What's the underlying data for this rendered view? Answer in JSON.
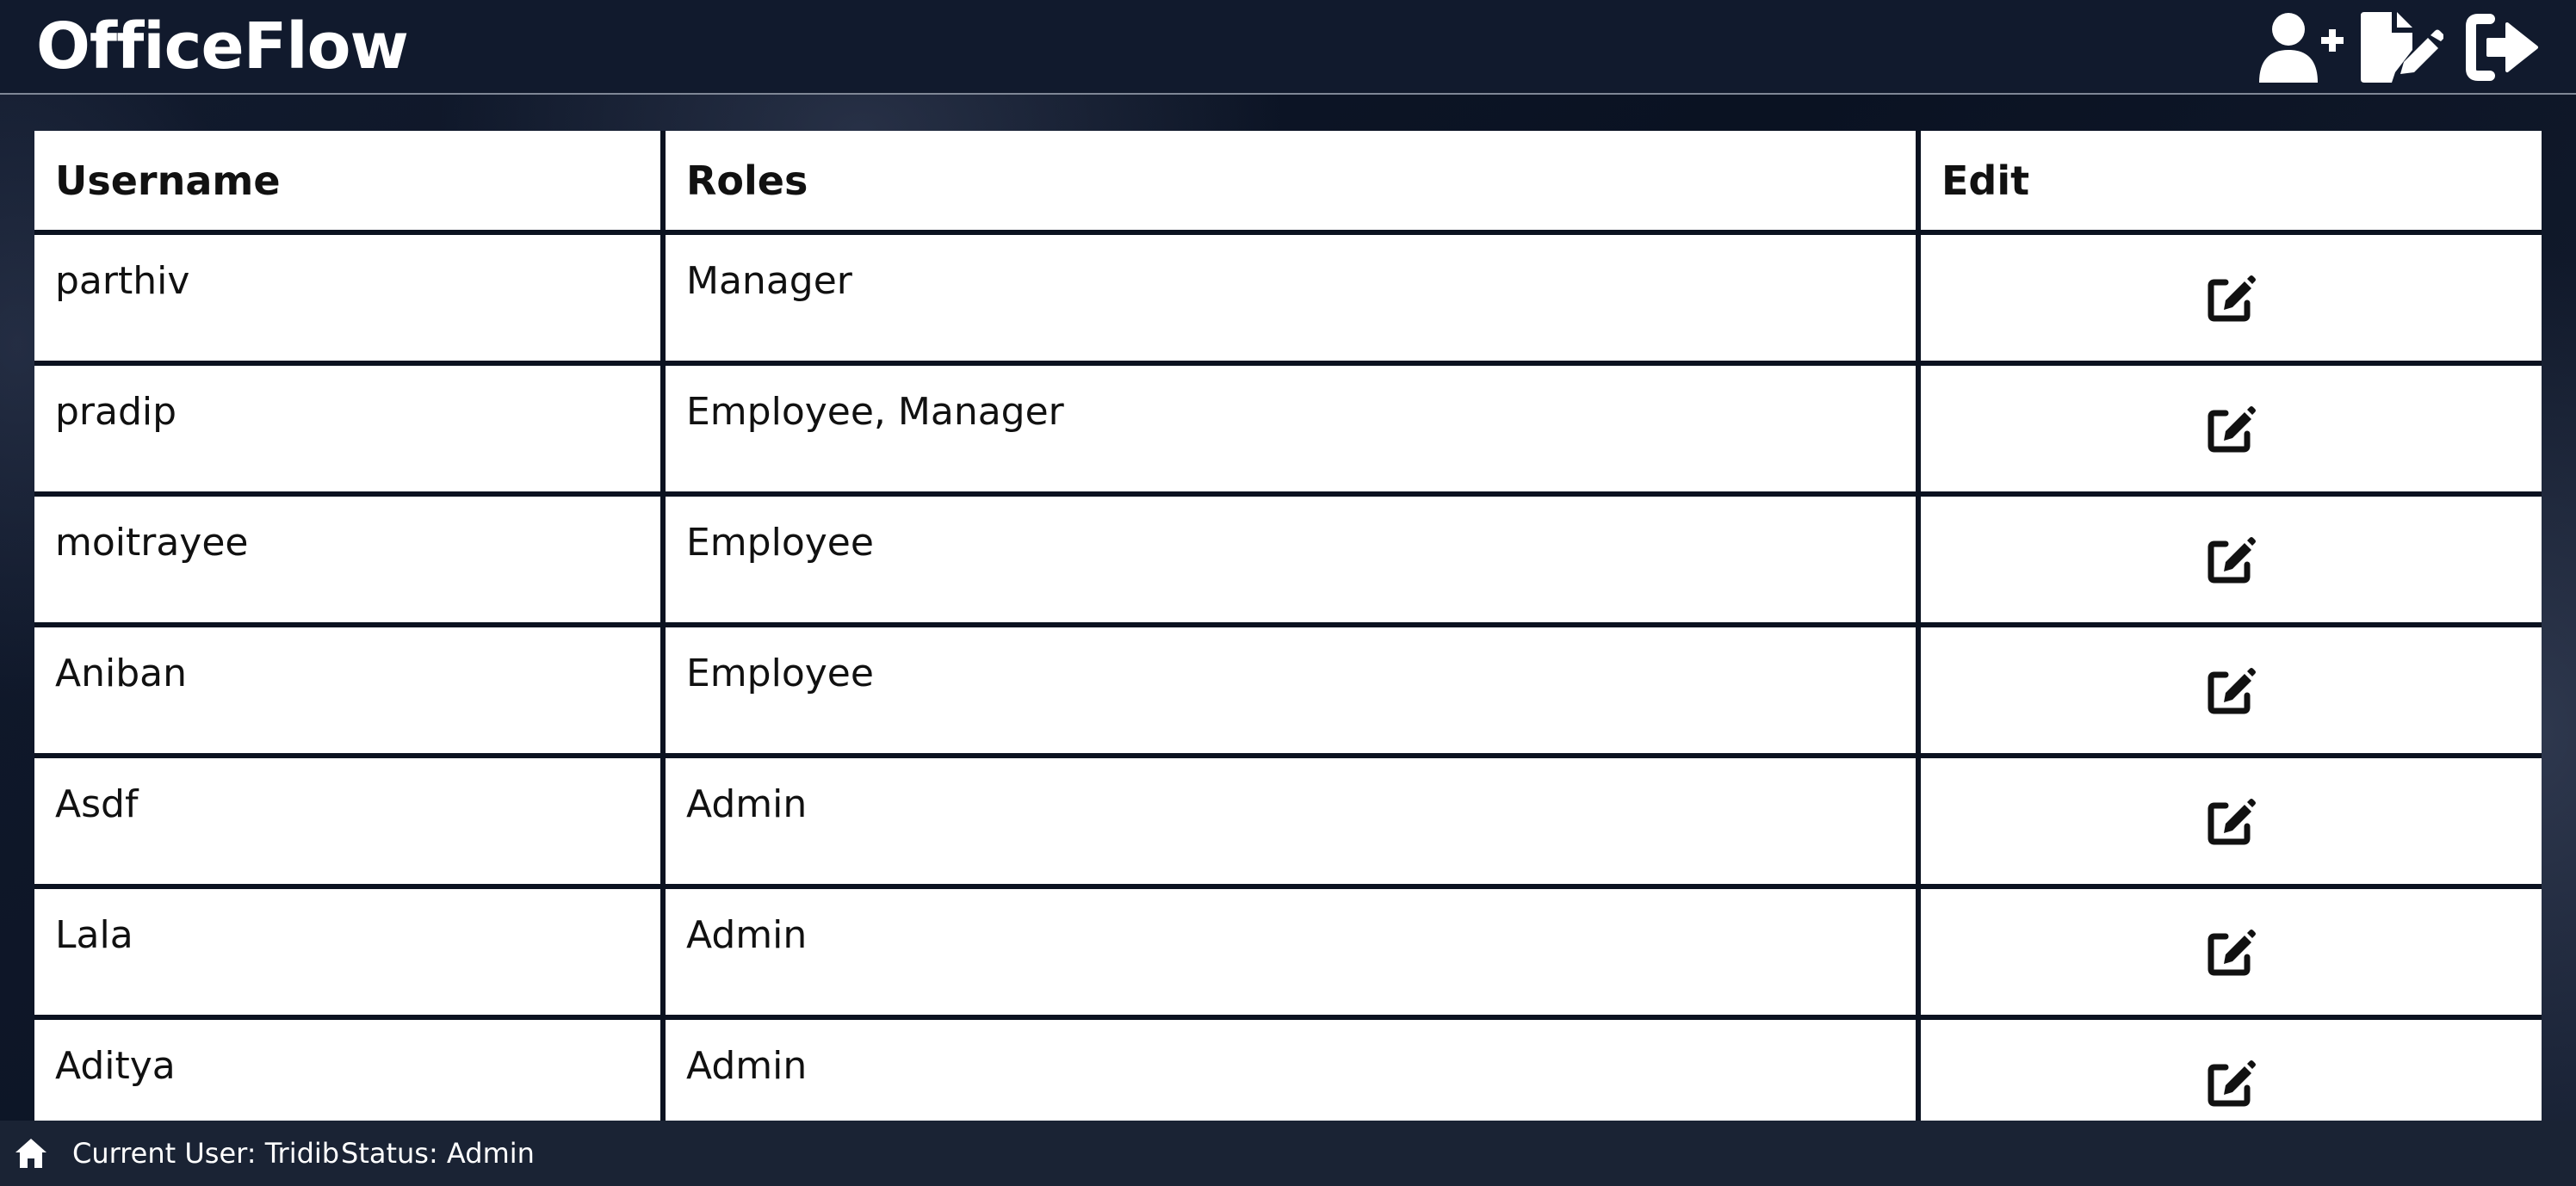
{
  "app": {
    "title": "OfficeFlow"
  },
  "toolbar": {
    "icons": [
      "add-user-icon",
      "edit-document-icon",
      "logout-icon"
    ]
  },
  "table": {
    "headers": {
      "username": "Username",
      "roles": "Roles",
      "edit": "Edit"
    },
    "rows": [
      {
        "username": "parthiv",
        "roles": "Manager"
      },
      {
        "username": "pradip",
        "roles": "Employee, Manager"
      },
      {
        "username": "moitrayee",
        "roles": "Employee"
      },
      {
        "username": "Aniban",
        "roles": "Employee"
      },
      {
        "username": "Asdf",
        "roles": "Admin"
      },
      {
        "username": "Lala",
        "roles": "Admin"
      },
      {
        "username": "Aditya",
        "roles": "Admin"
      }
    ]
  },
  "statusbar": {
    "current_user": "Current User: Tridib",
    "status": "Status: Admin"
  },
  "colors": {
    "header_bg": "#111a2d",
    "page_bg": "#0d1526",
    "table_cell_bg": "#ffffff",
    "grid_lines": "#0b1220",
    "statusbar_bg": "#1a2334"
  }
}
